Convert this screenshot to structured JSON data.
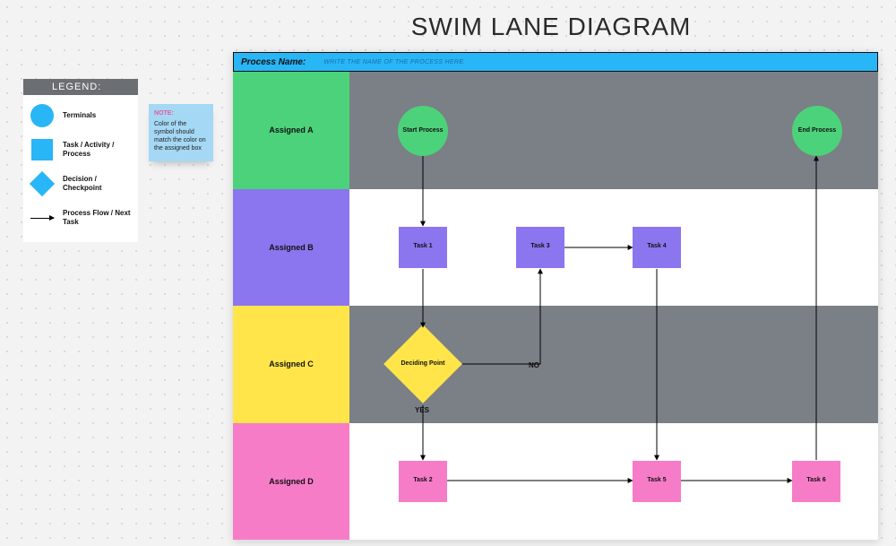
{
  "title": "SWIM LANE DIAGRAM",
  "legend": {
    "header": "LEGEND:",
    "items": [
      {
        "label": "Terminals"
      },
      {
        "label": "Task / Activity / Process"
      },
      {
        "label": "Decision / Checkpoint"
      },
      {
        "label": "Process Flow / Next Task"
      }
    ]
  },
  "note": {
    "title": "NOTE:",
    "body": "Color of the symbol should match the color on the assigned box"
  },
  "process": {
    "label": "Process Name:",
    "hint": "WRITE THE NAME OF THE PROCESS HERE."
  },
  "lanes": {
    "a": "Assigned A",
    "b": "Assigned B",
    "c": "Assigned C",
    "d": "Assigned D"
  },
  "nodes": {
    "start": "Start Process",
    "end": "End Process",
    "task1": "Task 1",
    "task3": "Task 3",
    "task4": "Task 4",
    "decide": "Deciding Point",
    "no": "NO",
    "yes": "YES",
    "task2": "Task 2",
    "task5": "Task 5",
    "task6": "Task 6"
  },
  "colors": {
    "blue": "#29b6f6",
    "green": "#4cd27a",
    "purple": "#8b76f0",
    "yellow": "#ffe54a",
    "pink": "#f77cc8",
    "grey": "#7b7f86"
  },
  "chart_data": {
    "type": "swimlane",
    "title": "SWIM LANE DIAGRAM",
    "lanes": [
      {
        "id": "A",
        "name": "Assigned A",
        "color": "#4cd27a"
      },
      {
        "id": "B",
        "name": "Assigned B",
        "color": "#8b76f0"
      },
      {
        "id": "C",
        "name": "Assigned C",
        "color": "#ffe54a"
      },
      {
        "id": "D",
        "name": "Assigned D",
        "color": "#f77cc8"
      }
    ],
    "nodes": [
      {
        "id": "start",
        "lane": "A",
        "type": "terminal",
        "label": "Start Process"
      },
      {
        "id": "end",
        "lane": "A",
        "type": "terminal",
        "label": "End Process"
      },
      {
        "id": "task1",
        "lane": "B",
        "type": "task",
        "label": "Task 1"
      },
      {
        "id": "task3",
        "lane": "B",
        "type": "task",
        "label": "Task 3"
      },
      {
        "id": "task4",
        "lane": "B",
        "type": "task",
        "label": "Task 4"
      },
      {
        "id": "decide",
        "lane": "C",
        "type": "decision",
        "label": "Deciding Point"
      },
      {
        "id": "task2",
        "lane": "D",
        "type": "task",
        "label": "Task 2"
      },
      {
        "id": "task5",
        "lane": "D",
        "type": "task",
        "label": "Task 5"
      },
      {
        "id": "task6",
        "lane": "D",
        "type": "task",
        "label": "Task 6"
      }
    ],
    "edges": [
      {
        "from": "start",
        "to": "task1"
      },
      {
        "from": "task1",
        "to": "decide"
      },
      {
        "from": "decide",
        "to": "task3",
        "label": "NO"
      },
      {
        "from": "decide",
        "to": "task2",
        "label": "YES"
      },
      {
        "from": "task3",
        "to": "task4"
      },
      {
        "from": "task4",
        "to": "task5"
      },
      {
        "from": "task2",
        "to": "task5"
      },
      {
        "from": "task5",
        "to": "task6"
      },
      {
        "from": "task6",
        "to": "end"
      }
    ]
  }
}
